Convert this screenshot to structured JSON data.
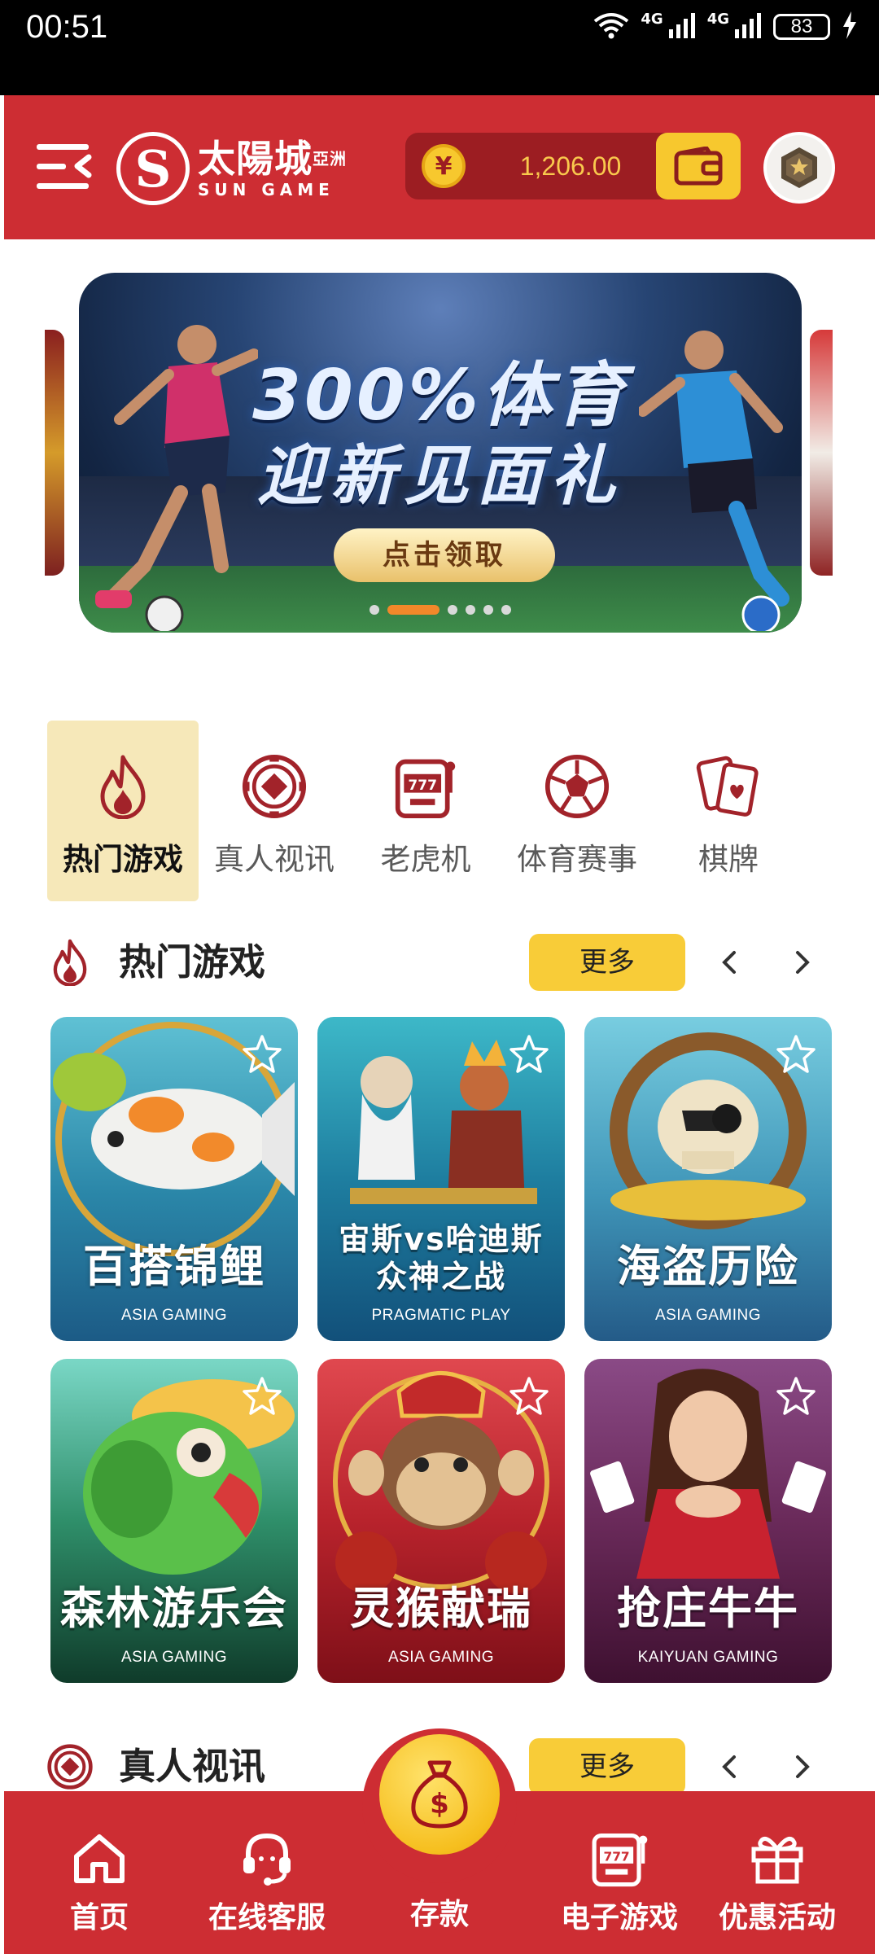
{
  "status_bar": {
    "time": "00:51",
    "network_1": "4G",
    "network_2": "4G",
    "battery": "83",
    "icons": [
      "wifi-icon",
      "signal-icon",
      "signal-icon",
      "battery-icon",
      "charging-icon"
    ]
  },
  "header": {
    "logo_cn": "太陽城",
    "logo_cn_small": "亞洲",
    "logo_en": "SUN GAME",
    "currency_symbol": "¥",
    "balance": "1,206.00",
    "colors": {
      "header_bg": "#cd2d33",
      "balance_bg": "#9c1d22",
      "accent_gold": "#f7c82e"
    }
  },
  "banner": {
    "title_line1": "300%体育",
    "title_line2": "迎新见面礼",
    "cta": "点击领取",
    "slide_count": 6,
    "active_slide": 2
  },
  "categories": [
    {
      "label": "热门游戏",
      "icon": "flame-icon",
      "active": true
    },
    {
      "label": "真人视讯",
      "icon": "casino-chip-icon",
      "active": false
    },
    {
      "label": "老虎机",
      "icon": "slot-machine-icon",
      "active": false
    },
    {
      "label": "体育赛事",
      "icon": "soccer-ball-icon",
      "active": false
    },
    {
      "label": "棋牌",
      "icon": "playing-cards-icon",
      "active": false
    }
  ],
  "hot_section": {
    "title": "热门游戏",
    "more": "更多",
    "games": [
      {
        "name": "百搭锦鲤",
        "provider": "ASIA GAMING"
      },
      {
        "name_line1": "宙斯vs哈迪斯",
        "name_line2": "众神之战",
        "provider": "PRAGMATIC PLAY"
      },
      {
        "name": "海盗历险",
        "provider": "ASIA GAMING"
      },
      {
        "name": "森林游乐会",
        "provider": "ASIA GAMING"
      },
      {
        "name": "灵猴献瑞",
        "provider": "ASIA GAMING"
      },
      {
        "name": "抢庄牛牛",
        "provider": "KAIYUAN GAMING"
      }
    ]
  },
  "live_section": {
    "title": "真人视讯",
    "more": "更多"
  },
  "tabbar": {
    "home": "首页",
    "support": "在线客服",
    "deposit": "存款",
    "egames": "电子游戏",
    "promotions": "优惠活动"
  }
}
